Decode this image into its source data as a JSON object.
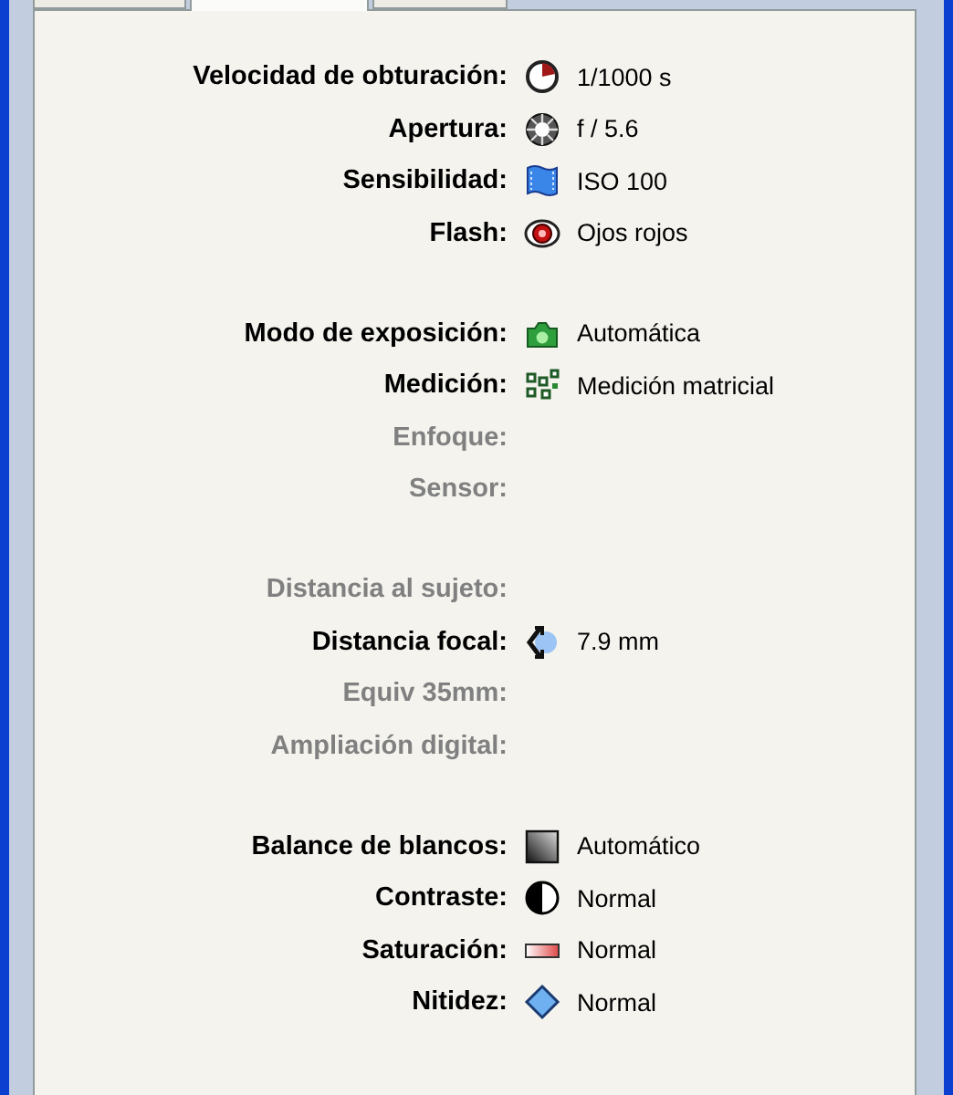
{
  "tabs": [
    {
      "selected": false
    },
    {
      "selected": true
    },
    {
      "selected": false
    }
  ],
  "groups": [
    {
      "rows": [
        {
          "label": "Velocidad de obturación:",
          "kind": "shutter",
          "value": "1/1000 s",
          "disabled": false
        },
        {
          "label": "Apertura:",
          "kind": "aperture",
          "value": "f / 5.6",
          "disabled": false
        },
        {
          "label": "Sensibilidad:",
          "kind": "film",
          "value": "ISO 100",
          "disabled": false
        },
        {
          "label": "Flash:",
          "kind": "eye",
          "value": "Ojos rojos",
          "disabled": false
        }
      ]
    },
    {
      "rows": [
        {
          "label": "Modo de exposición:",
          "kind": "camera",
          "value": "Automática",
          "disabled": false
        },
        {
          "label": "Medición:",
          "kind": "matrix",
          "value": "Medición matricial",
          "disabled": false
        },
        {
          "label": "Enfoque:",
          "disabled": true
        },
        {
          "label": "Sensor:",
          "disabled": true
        }
      ]
    },
    {
      "rows": [
        {
          "label": "Distancia al sujeto:",
          "disabled": true
        },
        {
          "label": "Distancia focal:",
          "kind": "focal",
          "value": "7.9 mm",
          "disabled": false
        },
        {
          "label": "Equiv 35mm:",
          "disabled": true
        },
        {
          "label": "Ampliación digital:",
          "disabled": true
        }
      ]
    },
    {
      "rows": [
        {
          "label": "Balance de blancos:",
          "kind": "whitebalance",
          "value": "Automático",
          "disabled": false
        },
        {
          "label": "Contraste:",
          "kind": "contrast",
          "value": "Normal",
          "disabled": false
        },
        {
          "label": "Saturación:",
          "kind": "saturation",
          "value": "Normal",
          "disabled": false
        },
        {
          "label": "Nitidez:",
          "kind": "sharpness",
          "value": "Normal",
          "disabled": false
        }
      ]
    }
  ]
}
